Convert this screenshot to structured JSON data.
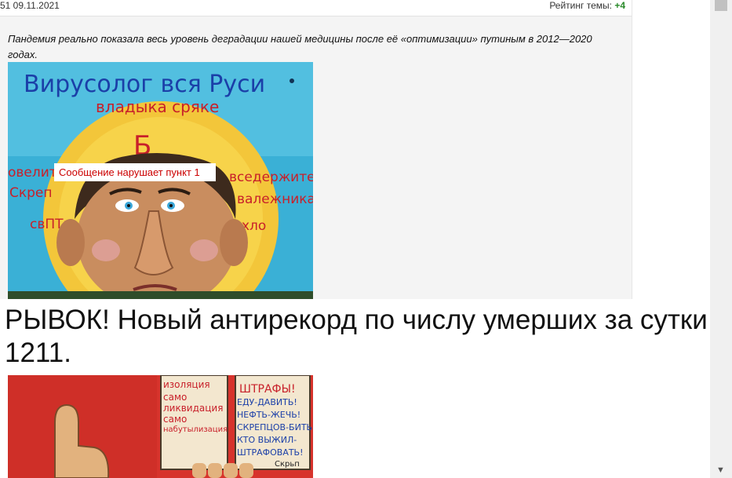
{
  "meta": {
    "date": "51 09.11.2021",
    "rating_label": "Рейтинг темы:",
    "rating_value": "+4"
  },
  "post": {
    "text": "Пандемия реально показала весь уровень деградации нашей медицины после её «оптимизации» путиным в 2012—2020 годах.",
    "image1": {
      "title_line1": "Вирусолог вся Руси",
      "title_line2": "владыка сряке",
      "warning": "Сообщение нарушает пункт 1",
      "left_words": [
        "овелитель",
        "Скреп",
        "свПТн"
      ],
      "right_words": [
        "вседержитель",
        "валежника",
        "хло"
      ]
    }
  },
  "headline": {
    "line1": "РЫВОК! Новый антирекорд по числу умерших за сутки –",
    "line2": "1211."
  },
  "image2": {
    "left_words": [
      "изоляция",
      "само",
      "ликвидация",
      "само",
      "набутылизация"
    ],
    "right_words": [
      "ШТРАФЫ!",
      "ЕДУ-ДАВИТЬ!",
      "НЕФТЬ-ЖЕЧЬ!",
      "СКРЕПЦОВ-БИТЬ!",
      "КТО ВЫЖИЛ-",
      "ШТРАФОВАТЬ!"
    ],
    "signature": "Скрьп"
  }
}
